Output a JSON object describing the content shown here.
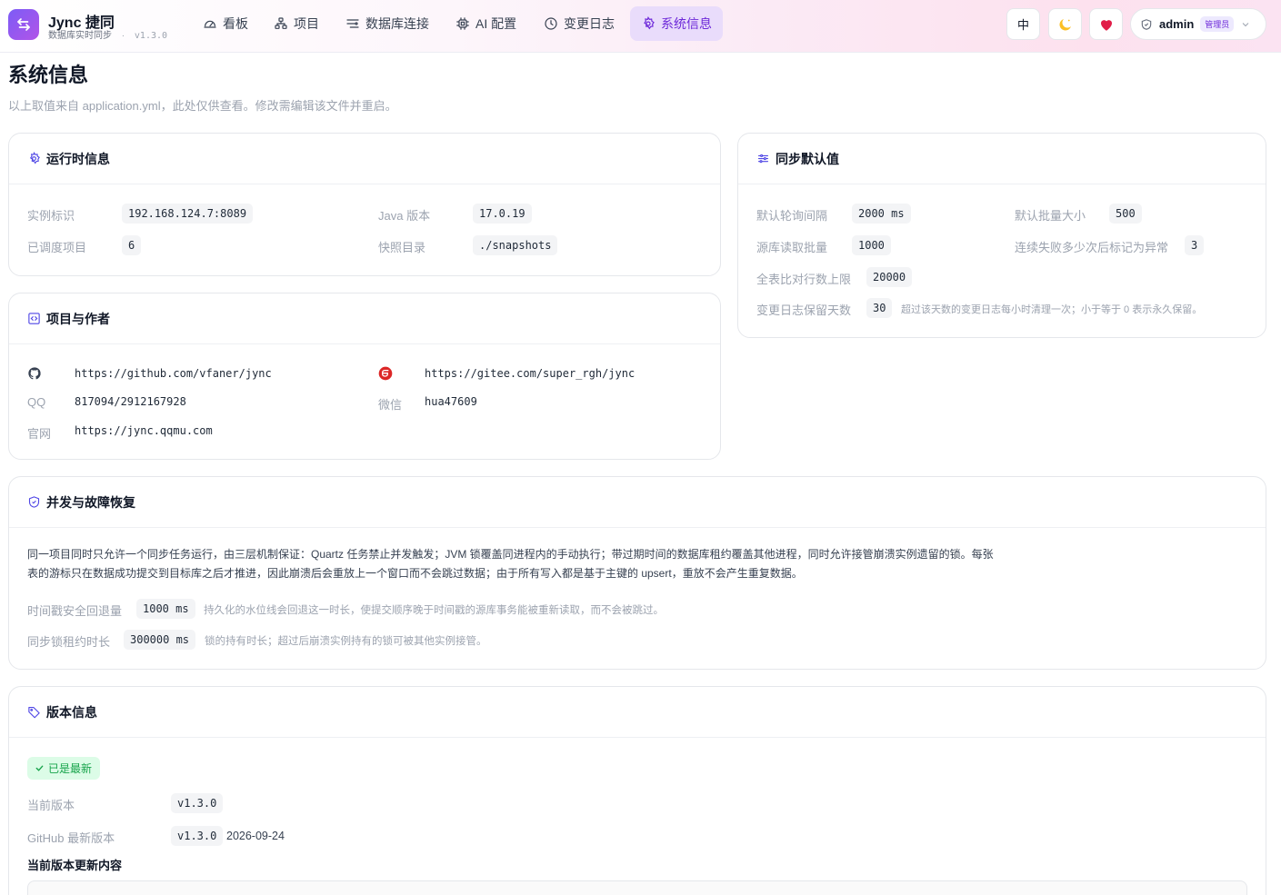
{
  "brand": {
    "name": "Jync 捷同",
    "subtitle": "数据库实时同步",
    "separator": "·",
    "version": "v1.3.0"
  },
  "nav": [
    {
      "label": "看板",
      "icon": "dashboard-icon"
    },
    {
      "label": "项目",
      "icon": "project-icon"
    },
    {
      "label": "数据库连接",
      "icon": "database-connection-icon"
    },
    {
      "label": "AI 配置",
      "icon": "ai-chip-icon"
    },
    {
      "label": "变更日志",
      "icon": "clock-icon"
    },
    {
      "label": "系统信息",
      "icon": "gear-icon",
      "active": true
    }
  ],
  "header": {
    "lang_label": "中",
    "theme_icon": "moon-icon",
    "favorite_icon": "heart-icon",
    "user": "admin",
    "role": "管理员"
  },
  "page": {
    "title": "系统信息",
    "description": "以上取值来自 application.yml，此处仅供查看。修改需编辑该文件并重启。"
  },
  "runtime": {
    "title": "运行时信息",
    "instance_label": "实例标识",
    "instance_value": "192.168.124.7:8089",
    "java_label": "Java 版本",
    "java_value": "17.0.19",
    "scheduled_label": "已调度项目",
    "scheduled_value": "6",
    "snapshot_label": "快照目录",
    "snapshot_value": "./snapshots"
  },
  "sync_defaults": {
    "title": "同步默认值",
    "poll_label": "默认轮询间隔",
    "poll_value": "2000 ms",
    "batch_label": "默认批量大小",
    "batch_value": "500",
    "read_label": "源库读取批量",
    "read_value": "1000",
    "fail_label": "连续失败多少次后标记为异常",
    "fail_value": "3",
    "compare_label": "全表比对行数上限",
    "compare_value": "20000",
    "retention_label": "变更日志保留天数",
    "retention_value": "30",
    "retention_note": "超过该天数的变更日志每小时清理一次；小于等于 0 表示永久保留。"
  },
  "project_author": {
    "title": "项目与作者",
    "github_url": "https://github.com/vfaner/jync",
    "gitee_url": "https://gitee.com/super_rgh/jync",
    "qq_label": "QQ",
    "qq_value": "817094/2912167928",
    "wechat_label": "微信",
    "wechat_value": "hua47609",
    "site_label": "官网",
    "site_value": "https://jync.qqmu.com"
  },
  "concurrency": {
    "title": "并发与故障恢复",
    "paragraph": "同一项目同时只允许一个同步任务运行，由三层机制保证：Quartz 任务禁止并发触发；JVM 锁覆盖同进程内的手动执行；带过期时间的数据库租约覆盖其他进程，同时允许接管崩溃实例遗留的锁。每张表的游标只在数据成功提交到目标库之后才推进，因此崩溃后会重放上一个窗口而不会跳过数据；由于所有写入都是基于主键的 upsert，重放不会产生重复数据。",
    "rollback_label": "时间戳安全回退量",
    "rollback_value": "1000 ms",
    "rollback_note": "持久化的水位线会回退这一时长，使提交顺序晚于时间戳的源库事务能被重新读取，而不会被跳过。",
    "lease_label": "同步锁租约时长",
    "lease_value": "300000 ms",
    "lease_note": "锁的持有时长；超过后崩溃实例持有的锁可被其他实例接管。"
  },
  "version_info": {
    "title": "版本信息",
    "status": "已是最新",
    "current_label": "当前版本",
    "current_value": "v1.3.0",
    "latest_label": "GitHub 最新版本",
    "latest_value": "v1.3.0",
    "latest_date": "2026-09-24",
    "changelog_title": "当前版本更新内容"
  },
  "colors": {
    "accent": "#6d28d9",
    "active_nav_bg": "#e9dcfb",
    "success": "#16a34a",
    "heart": "#e11d48"
  }
}
